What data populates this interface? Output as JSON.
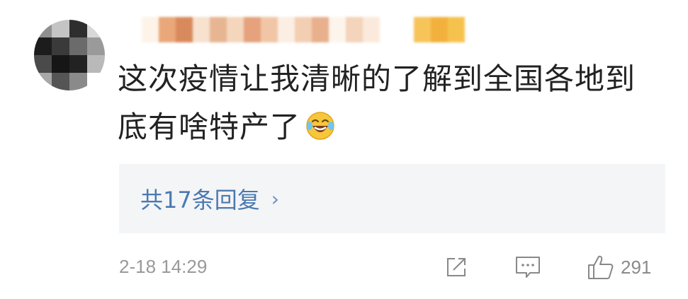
{
  "comment": {
    "text": "这次疫情让我清晰的了解到全国各地到底有啥特产了",
    "emoji": "laugh-cry-icon",
    "replies_label": "共17条回复",
    "timestamp": "2-18 14:29",
    "likes": "291"
  },
  "icons": {
    "share": "share-icon",
    "comment": "comment-icon",
    "like": "thumbs-up-icon",
    "chevron": "chevron-right-icon"
  },
  "colors": {
    "link": "#4a7ab1",
    "meta": "#999999",
    "reply_bg": "#f4f5f7"
  }
}
